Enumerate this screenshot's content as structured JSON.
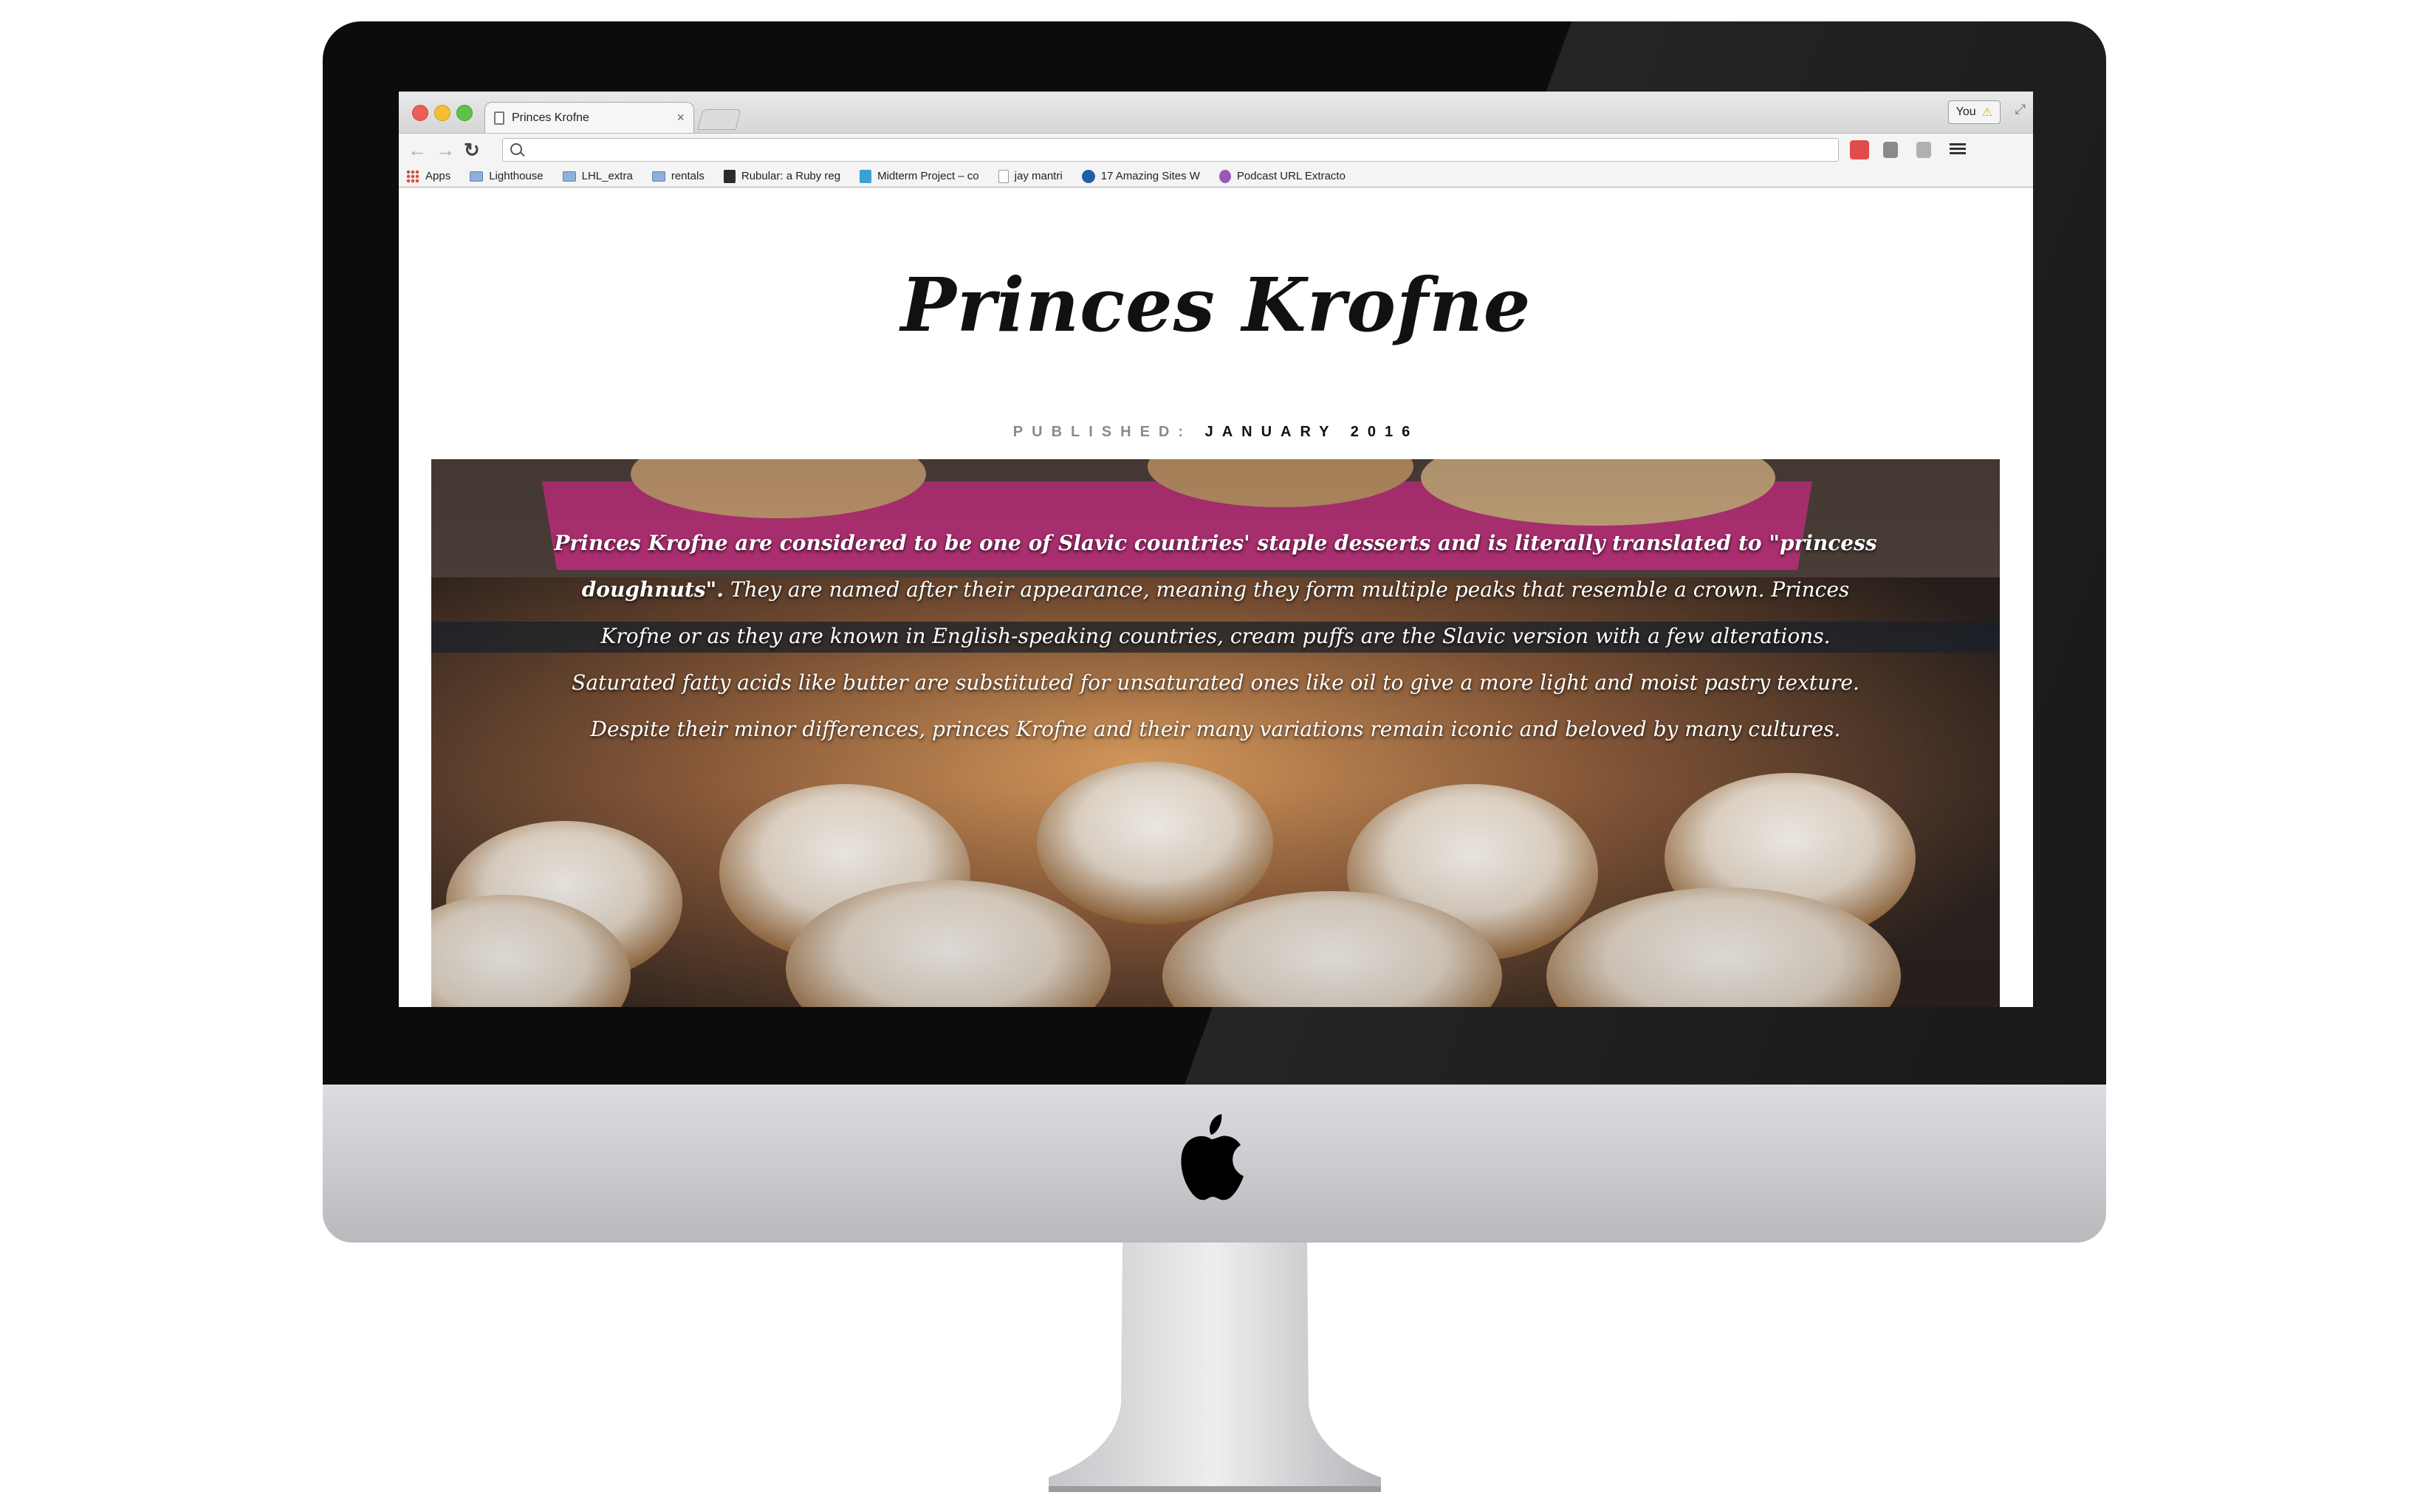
{
  "browser": {
    "tab_title": "Princes Krofne",
    "tab_close": "×",
    "profile_label": "You",
    "profile_warning": "⚠",
    "nav": {
      "back": "←",
      "forward": "→",
      "reload": "↻"
    },
    "bookmarks": [
      {
        "label": "Apps",
        "icon": "apps-grid-icon"
      },
      {
        "label": "Lighthouse",
        "icon": "folder-icon"
      },
      {
        "label": "LHL_extra",
        "icon": "folder-icon"
      },
      {
        "label": "rentals",
        "icon": "folder-icon"
      },
      {
        "label": "Rubular: a Ruby reg",
        "icon": "rubular-icon"
      },
      {
        "label": "Midterm Project – co",
        "icon": "doc-icon"
      },
      {
        "label": "jay mantri",
        "icon": "page-icon"
      },
      {
        "label": "17 Amazing Sites W",
        "icon": "site-icon"
      },
      {
        "label": "Podcast URL Extracto",
        "icon": "podcast-icon"
      }
    ]
  },
  "page": {
    "title": "Princes Krofne",
    "published_label": "PUBLISHED:",
    "published_date": "JANUARY 2016",
    "hero_lead": "Princes Krofne are considered to be one of Slavic countries' staple desserts and is literally translated to \"princess doughnuts\".",
    "hero_body": "They are named after their appearance, meaning they form multiple peaks that resemble a crown. Princes Krofne or as they are known in English-speaking countries, cream puffs are the Slavic version with a few alterations. Saturated fatty acids like butter are substituted for unsaturated ones like oil to give a more light and moist pastry texture. Despite their minor differences, princes Krofne and their many variations remain iconic and beloved by many cultures."
  },
  "colors": {
    "bezel": "#0c0c0c",
    "chin": "#c9cacd",
    "accent_pink": "#d23a8a",
    "hero_text": "#ffffff"
  }
}
